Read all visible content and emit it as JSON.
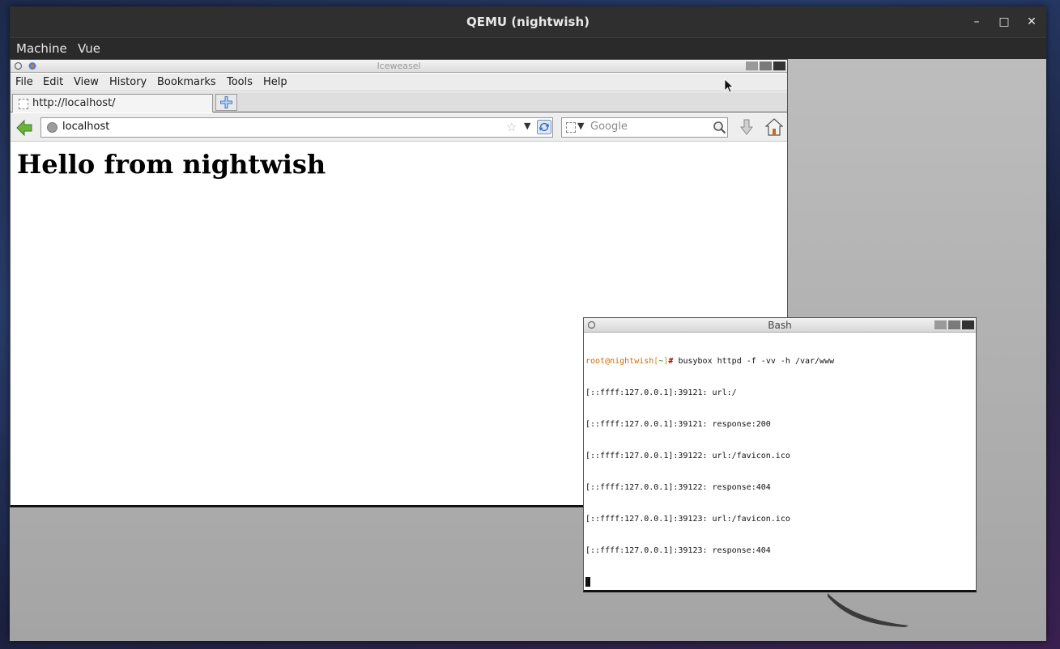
{
  "host_window": {
    "title": "QEMU (nightwish)",
    "controls": {
      "minimize": "–",
      "maximize": "□",
      "close": "✕"
    },
    "menu": [
      {
        "label": "Machine"
      },
      {
        "label": "Vue"
      }
    ]
  },
  "iceweasel": {
    "window_title": "Iceweasel",
    "menu": [
      {
        "label": "File"
      },
      {
        "label": "Edit"
      },
      {
        "label": "View"
      },
      {
        "label": "History"
      },
      {
        "label": "Bookmarks"
      },
      {
        "label": "Tools"
      },
      {
        "label": "Help"
      }
    ],
    "tab_label": "http://localhost/",
    "address_value": "localhost",
    "search_placeholder": "Google",
    "page_heading": "Hello from nightwish"
  },
  "bash": {
    "window_title": "Bash",
    "prompt": {
      "user_host": "root@nightwish",
      "open": "[",
      "path": "~",
      "close": "]",
      "symbol": "#"
    },
    "command": "busybox httpd -f -vv -h /var/www",
    "output": [
      "[::ffff:127.0.0.1]:39121: url:/",
      "[::ffff:127.0.0.1]:39121: response:200",
      "[::ffff:127.0.0.1]:39122: url:/favicon.ico",
      "[::ffff:127.0.0.1]:39122: response:404",
      "[::ffff:127.0.0.1]:39123: url:/favicon.ico",
      "[::ffff:127.0.0.1]:39123: response:404"
    ]
  },
  "colors": {
    "host_titlebar": "#2f2f2f",
    "guest_desktop": "#b4b4b4",
    "prompt_user": "#d66a00",
    "prompt_hash": "#b00000",
    "nav_arrow_green": "#5aa02c"
  },
  "icons": [
    "back-arrow-icon",
    "globe-icon",
    "star-icon",
    "reload-icon",
    "magnifier-icon",
    "download-icon",
    "home-icon",
    "new-tab-icon",
    "mouse-pointer-icon"
  ]
}
